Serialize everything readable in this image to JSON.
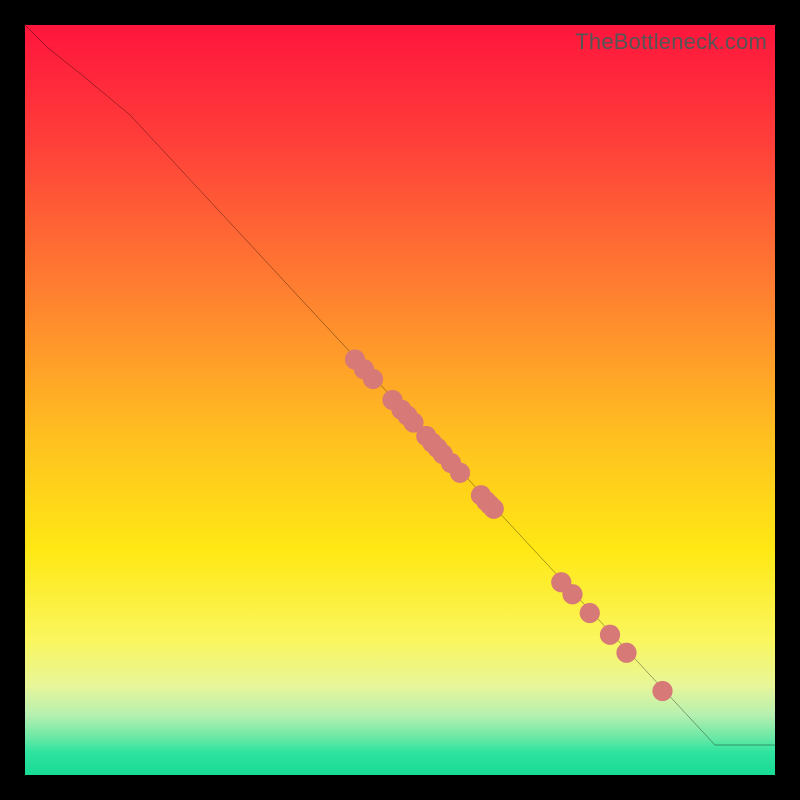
{
  "watermark": "TheBottleneck.com",
  "colors": {
    "bg": "#000000",
    "dot": "#d77a77",
    "line": "#000000",
    "grad_stops": [
      {
        "p": 0,
        "c": "#ff153c"
      },
      {
        "p": 15,
        "c": "#ff3d3a"
      },
      {
        "p": 35,
        "c": "#ff7e31"
      },
      {
        "p": 55,
        "c": "#ffc020"
      },
      {
        "p": 70,
        "c": "#ffe814"
      },
      {
        "p": 82,
        "c": "#faf65e"
      },
      {
        "p": 88,
        "c": "#e8f698"
      },
      {
        "p": 92,
        "c": "#b6f0b0"
      },
      {
        "p": 95,
        "c": "#6be8a5"
      },
      {
        "p": 97,
        "c": "#2ee3a0"
      },
      {
        "p": 100,
        "c": "#18db95"
      }
    ]
  },
  "chart_data": {
    "type": "line",
    "title": "",
    "xlabel": "",
    "ylabel": "",
    "xlim": [
      0,
      100
    ],
    "ylim": [
      0,
      100
    ],
    "series": [
      {
        "name": "curve",
        "x": [
          0,
          3,
          8,
          14,
          92,
          100
        ],
        "y": [
          100,
          97,
          93,
          88,
          4,
          4
        ]
      }
    ],
    "markers": {
      "name": "dots",
      "points": [
        {
          "x": 44.0,
          "y": 55.4
        },
        {
          "x": 45.2,
          "y": 54.1
        },
        {
          "x": 46.4,
          "y": 52.8
        },
        {
          "x": 49.0,
          "y": 50.0
        },
        {
          "x": 50.2,
          "y": 48.7
        },
        {
          "x": 51.0,
          "y": 47.9
        },
        {
          "x": 51.8,
          "y": 47.0
        },
        {
          "x": 53.5,
          "y": 45.2
        },
        {
          "x": 54.3,
          "y": 44.3
        },
        {
          "x": 55.0,
          "y": 43.6
        },
        {
          "x": 55.7,
          "y": 42.8
        },
        {
          "x": 56.8,
          "y": 41.6
        },
        {
          "x": 58.0,
          "y": 40.3
        },
        {
          "x": 60.8,
          "y": 37.3
        },
        {
          "x": 61.5,
          "y": 36.5
        },
        {
          "x": 62.0,
          "y": 36.0
        },
        {
          "x": 62.5,
          "y": 35.5
        },
        {
          "x": 71.5,
          "y": 25.7
        },
        {
          "x": 73.0,
          "y": 24.1
        },
        {
          "x": 75.3,
          "y": 21.6
        },
        {
          "x": 78.0,
          "y": 18.7
        },
        {
          "x": 80.2,
          "y": 16.3
        },
        {
          "x": 85.0,
          "y": 11.2
        }
      ]
    }
  }
}
